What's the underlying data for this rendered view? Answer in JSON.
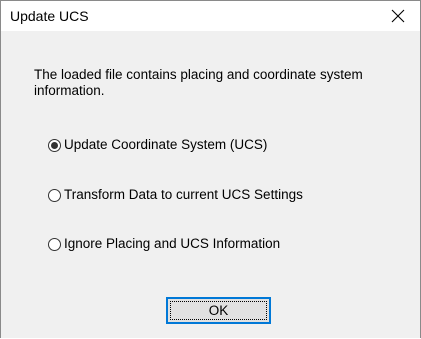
{
  "window": {
    "title": "Update UCS",
    "close_icon": "close-icon"
  },
  "message": "The loaded file contains placing and coordinate system information.",
  "options": [
    {
      "label": "Update Coordinate System (UCS)",
      "selected": true
    },
    {
      "label": "Transform Data to current UCS Settings",
      "selected": false
    },
    {
      "label": "Ignore Placing and UCS Information",
      "selected": false
    }
  ],
  "buttons": {
    "ok_label": "OK"
  },
  "colors": {
    "dialog_background": "#f0f0f0",
    "titlebar_background": "#ffffff",
    "button_focus_border": "#0078d7"
  }
}
